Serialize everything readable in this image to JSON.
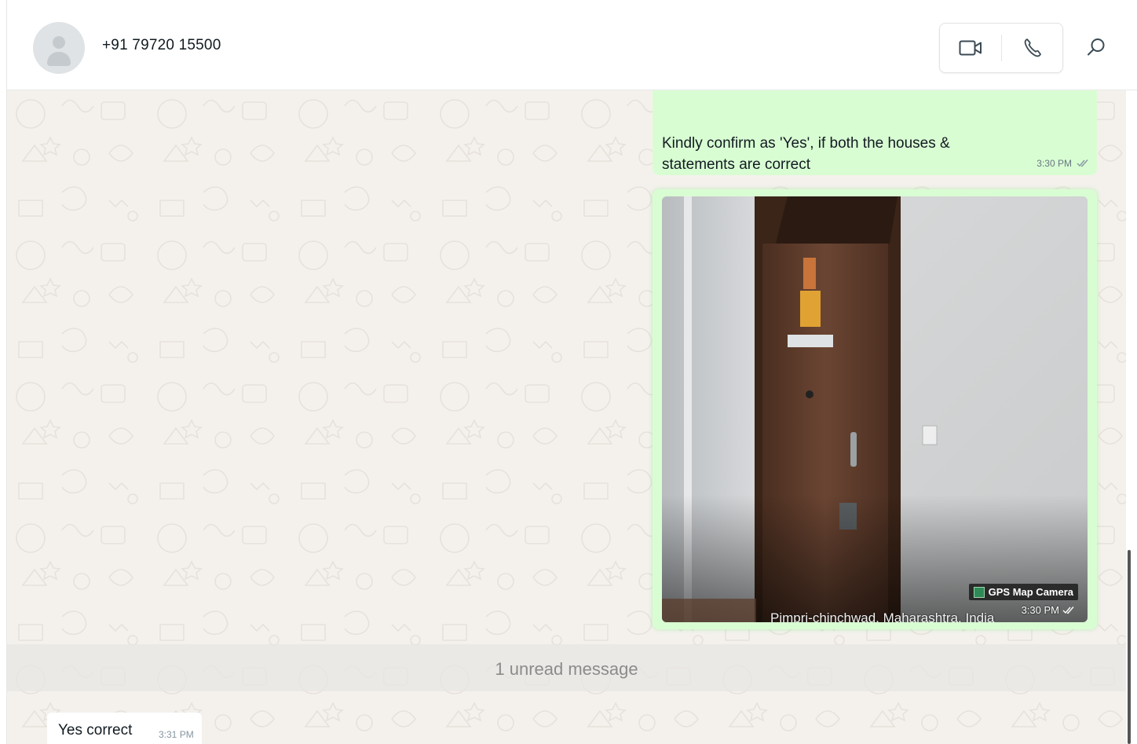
{
  "header": {
    "contact_name": "+91 79720 15500",
    "avatar_icon": "default-avatar-icon",
    "video_call_icon": "video-camera-icon",
    "voice_call_icon": "phone-icon",
    "search_icon": "search-icon"
  },
  "messages": [
    {
      "direction": "outgoing",
      "type": "text",
      "text": "Kindly confirm as 'Yes', if both the houses & statements are correct",
      "time": "3:30 PM",
      "status_icon": "double-check-icon"
    },
    {
      "direction": "outgoing",
      "type": "image",
      "image_description": "Photo of a brown wooden apartment door with a religious sticker and a name plate",
      "overlay_label": "GPS Map Camera",
      "location_text": "Pimpri-chinchwad, Maharashtra, India",
      "time": "3:30 PM",
      "status_icon": "double-check-icon"
    }
  ],
  "unread_banner": "1 unread message",
  "incoming": {
    "text": "Yes correct",
    "time": "3:31 PM"
  },
  "colors": {
    "outgoing_bubble": "#d9fdd3",
    "incoming_bubble": "#ffffff",
    "chat_background": "#f4f1ed",
    "meta_text": "#667781"
  }
}
